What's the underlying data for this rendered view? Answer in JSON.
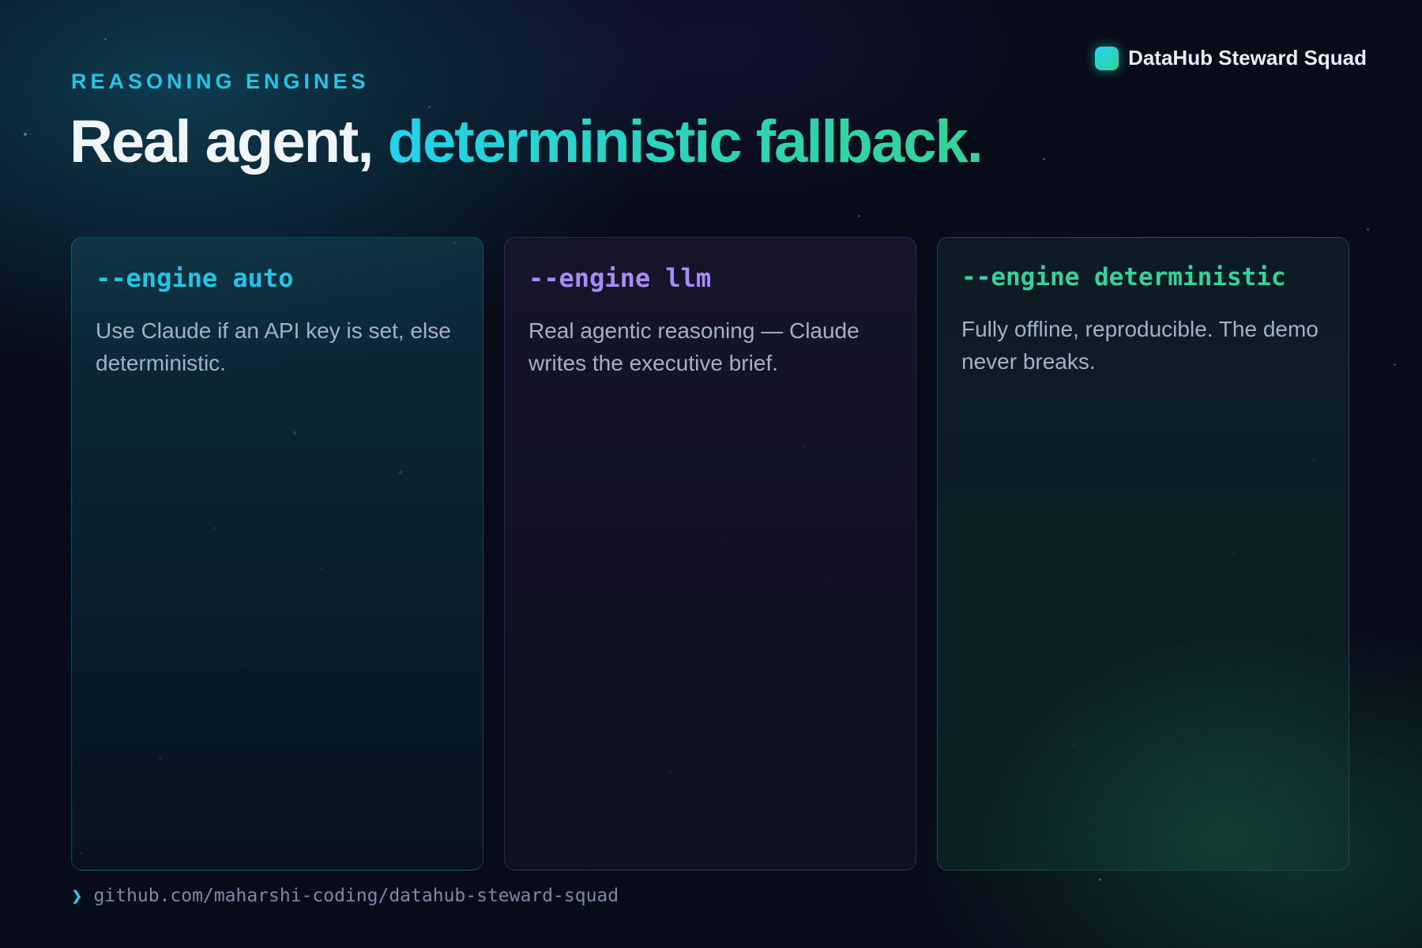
{
  "brand": {
    "name": "DataHub Steward Squad"
  },
  "header": {
    "eyebrow": "REASONING ENGINES",
    "title_plain": "Real agent,",
    "title_accent": "deterministic fallback."
  },
  "cards": [
    {
      "command": "--engine auto",
      "description": "Use Claude if an API key is set, else deterministic."
    },
    {
      "command": "--engine llm",
      "description": "Real agentic reasoning — Claude writes the executive brief."
    },
    {
      "command": "--engine deterministic",
      "description": "Fully offline, reproducible. The demo never breaks."
    }
  ],
  "footer": {
    "prompt_icon": "chevron-right-icon",
    "link": "github.com/maharshi-coding/datahub-steward-squad"
  },
  "colors": {
    "cyan": "#22c5e6",
    "violet": "#a78bfa",
    "green": "#34d399",
    "background": "#080c18"
  }
}
